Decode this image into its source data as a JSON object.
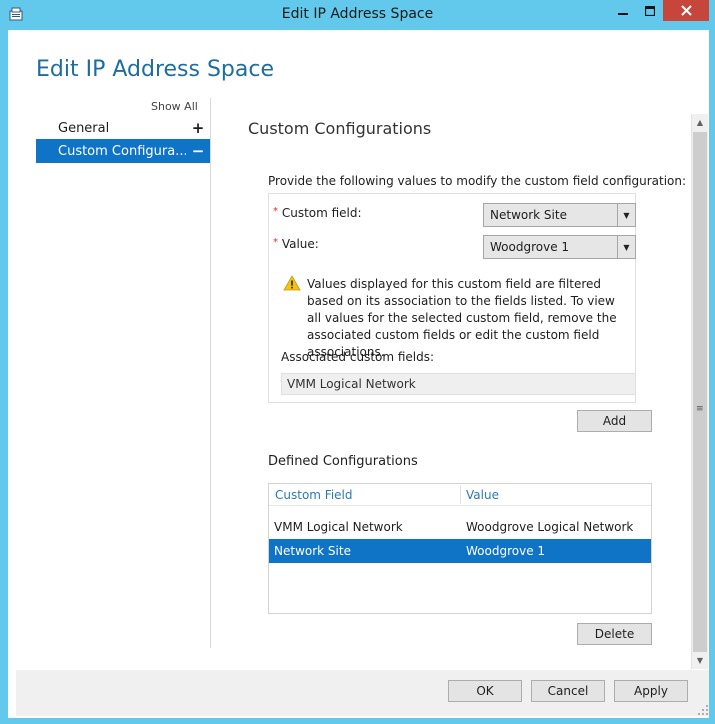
{
  "window": {
    "title": "Edit IP Address Space",
    "min_icon": "minimize-icon",
    "max_icon": "maximize-icon",
    "close_icon": "close-icon"
  },
  "page": {
    "title": "Edit IP Address Space"
  },
  "nav": {
    "show_all": "Show All",
    "items": [
      {
        "label": "General",
        "toggle": "+"
      },
      {
        "label": "Custom Configura...",
        "toggle": "−"
      }
    ]
  },
  "content": {
    "section_title": "Custom Configurations",
    "instructions": "Provide the following values to modify the custom field configuration:",
    "custom_field": {
      "label": "Custom field:",
      "value": "Network Site"
    },
    "value_field": {
      "label": "Value:",
      "value": "Woodgrove 1"
    },
    "required_marker": "*",
    "warning": "Values displayed for this custom field are filtered based on its association to the fields listed. To view all values for the selected custom field, remove the associated custom fields or edit the custom field associations.",
    "associated_label": "Associated custom fields:",
    "associated_value": "VMM Logical Network",
    "add_button": "Add",
    "defined_title": "Defined Configurations",
    "table": {
      "columns": [
        "Custom Field",
        "Value"
      ],
      "rows": [
        {
          "field": "VMM Logical Network",
          "value": "Woodgrove Logical Network",
          "selected": false
        },
        {
          "field": "Network Site",
          "value": "Woodgrove 1",
          "selected": true
        }
      ]
    },
    "delete_button": "Delete"
  },
  "footer": {
    "ok": "OK",
    "cancel": "Cancel",
    "apply": "Apply"
  },
  "colors": {
    "titlebar": "#62c9ec",
    "accent": "#0f74c5",
    "close": "#c7463b",
    "heading": "#1d6e9e"
  }
}
